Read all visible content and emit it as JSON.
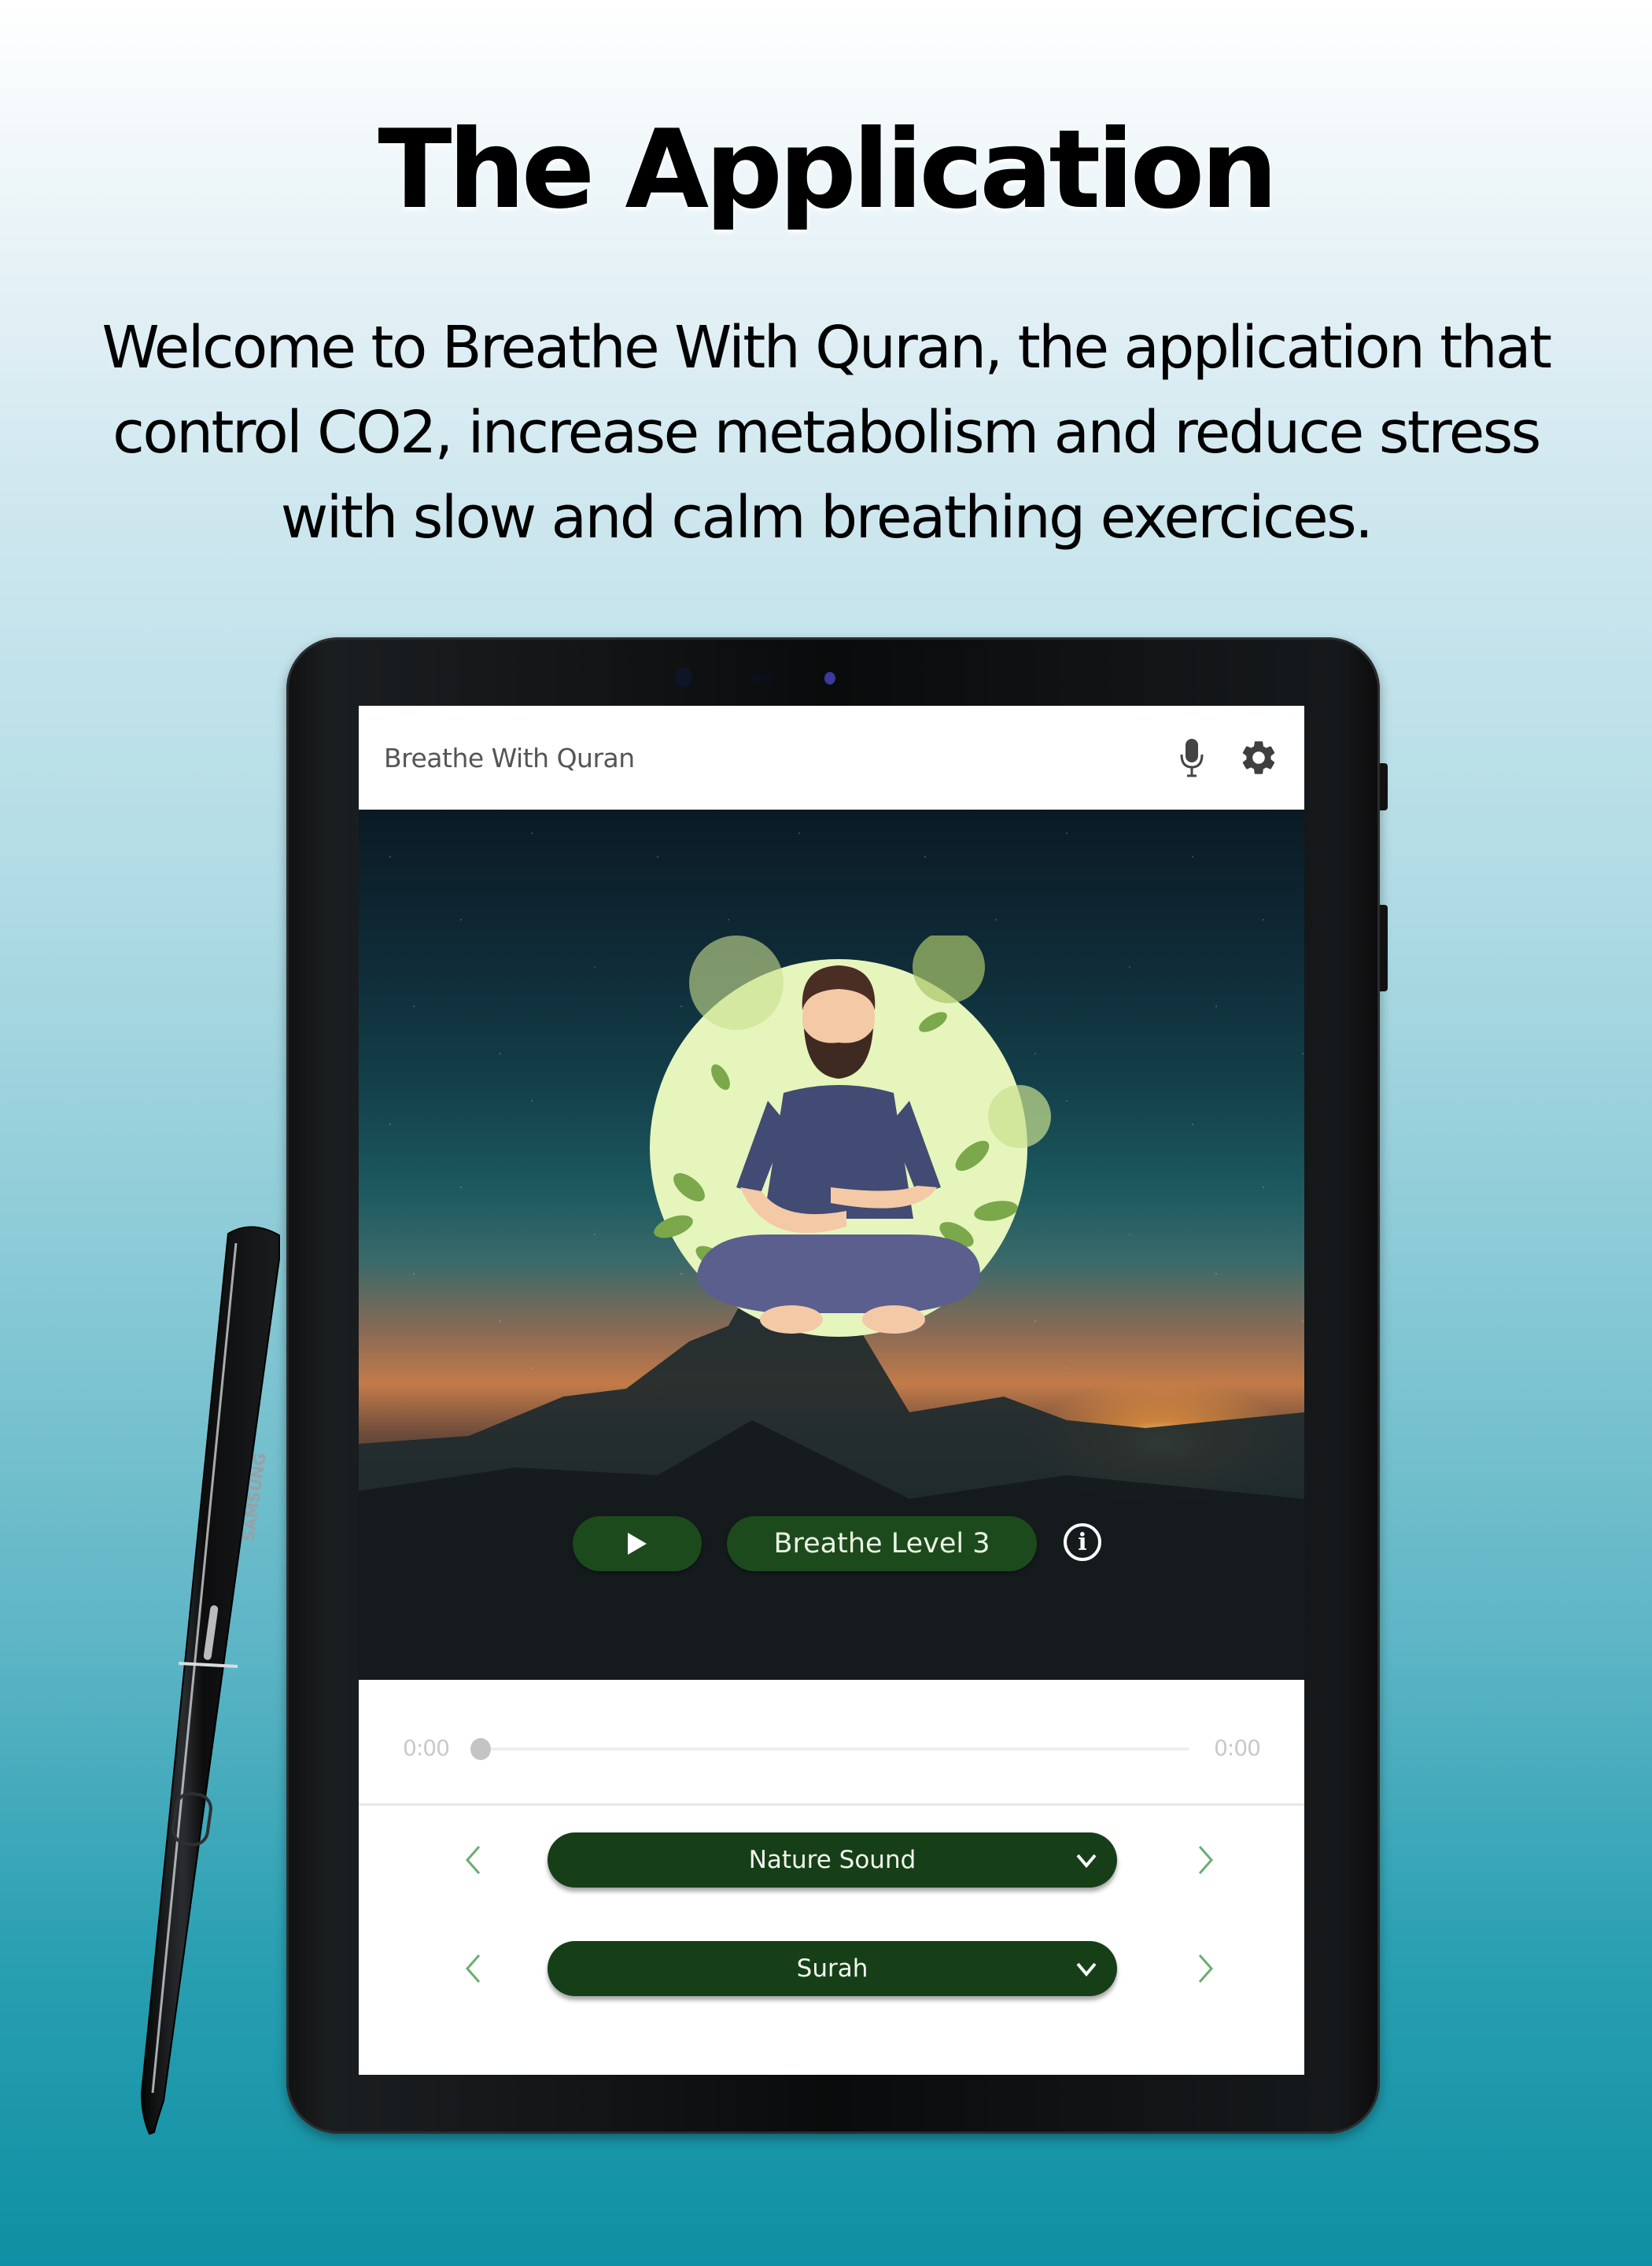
{
  "page": {
    "title": "The Application",
    "intro": "Welcome to Breathe With Quran, the application that control CO2, increase metabolism and reduce stress with slow and calm breathing exercices."
  },
  "device": {
    "stylus_brand": "SAMSUNG"
  },
  "app": {
    "title": "Breathe With Quran",
    "icons": {
      "mic": "microphone-icon",
      "settings": "gear-icon"
    },
    "hero": {
      "play_icon": "play-icon",
      "level_label": "Breathe Level 3",
      "info_icon": "info-icon"
    },
    "player": {
      "elapsed": "0:00",
      "duration": "0:00",
      "progress": 0
    },
    "selectors": [
      {
        "label": "Nature Sound",
        "prev_icon": "chevron-left-icon",
        "next_icon": "chevron-right-icon",
        "dropdown_icon": "chevron-down-icon"
      },
      {
        "label": "Surah",
        "prev_icon": "chevron-left-icon",
        "next_icon": "chevron-right-icon",
        "dropdown_icon": "chevron-down-icon"
      }
    ]
  },
  "colors": {
    "button_green": "#1d4a1c",
    "dropdown_green": "#163f18",
    "arrow_green": "#6aae6f",
    "bg_top": "#ffffff",
    "bg_bottom": "#0f8fa3"
  }
}
